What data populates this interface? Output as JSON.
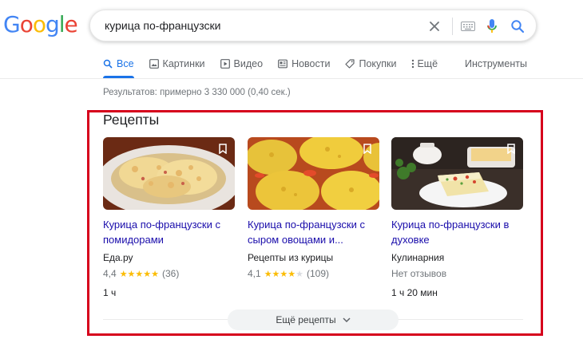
{
  "logo": {
    "text": "Google",
    "letters": [
      "G",
      "o",
      "o",
      "g",
      "l",
      "e"
    ],
    "colors": [
      "#4285f4",
      "#ea4335",
      "#fbbc05",
      "#4285f4",
      "#34a853",
      "#ea4335"
    ]
  },
  "search": {
    "query": "курица по-французски"
  },
  "tabs": [
    {
      "label": "Все",
      "icon": "search-icon",
      "active": true
    },
    {
      "label": "Картинки",
      "icon": "image-icon"
    },
    {
      "label": "Видео",
      "icon": "video-icon"
    },
    {
      "label": "Новости",
      "icon": "news-icon"
    },
    {
      "label": "Покупки",
      "icon": "tag-icon"
    },
    {
      "label": "Ещё",
      "icon": "more-vert-icon"
    }
  ],
  "tools_label": "Инструменты",
  "result_stats": "Результатов: примерно 3 330 000 (0,40 сек.)",
  "recipes": {
    "title": "Рецепты",
    "cards": [
      {
        "title": "Курица по-французски с помидорами",
        "source": "Еда.ру",
        "rating_value": "4,4",
        "stars": 4.4,
        "reviews": "(36)",
        "time": "1 ч"
      },
      {
        "title": "Курица по-французски с сыром овощами и...",
        "source": "Рецепты из курицы",
        "rating_value": "4,1",
        "stars": 4.1,
        "reviews": "(109)",
        "time": ""
      },
      {
        "title": "Курица по-французски в духовке",
        "source": "Кулинарния",
        "no_reviews": "Нет отзывов",
        "time": "1 ч 20 мин"
      }
    ],
    "more_label": "Ещё рецепты"
  },
  "accent_colors": {
    "link": "#1a0dab",
    "active_tab": "#1a73e8",
    "highlight_box": "#d6001c",
    "stars": "#fbbc04"
  }
}
